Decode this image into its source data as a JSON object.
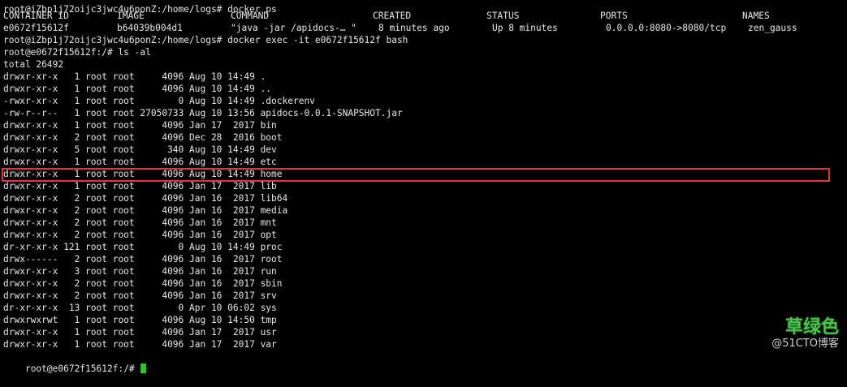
{
  "terminal": {
    "header_lines": [
      "root@iZbp1j72oijc3jwc4u6ponZ:/home/logs# docker ps"
    ],
    "ps_header": {
      "container_id": "CONTAINER ID",
      "image": "IMAGE",
      "command": "COMMAND",
      "created": "CREATED",
      "status": "STATUS",
      "ports": "PORTS",
      "names": "NAMES"
    },
    "ps_row": {
      "container_id": "e0672f15612f",
      "image": "b64039b004d1",
      "command": "\"java -jar /apidocs-… \"",
      "created": "8 minutes ago",
      "status": "Up 8 minutes",
      "ports": "0.0.0.0:8080->8080/tcp",
      "names": "zen_gauss"
    },
    "after_lines": [
      "root@iZbp1j72oijc3jwc4u6ponZ:/home/logs# docker exec -it e0672f15612f bash",
      "root@e0672f15612f:/# ls -al",
      "total 26492"
    ],
    "listing": [
      "drwxr-xr-x   1 root root     4096 Aug 10 14:49 .",
      "drwxr-xr-x   1 root root     4096 Aug 10 14:49 ..",
      "-rwxr-xr-x   1 root root        0 Aug 10 14:49 .dockerenv",
      "-rw-r--r--   1 root root 27050733 Aug 10 13:56 apidocs-0.0.1-SNAPSHOT.jar",
      "drwxr-xr-x   1 root root     4096 Jan 17  2017 bin",
      "drwxr-xr-x   2 root root     4096 Dec 28  2016 boot",
      "drwxr-xr-x   5 root root      340 Aug 10 14:49 dev",
      "drwxr-xr-x   1 root root     4096 Aug 10 14:49 etc",
      "drwxr-xr-x   1 root root     4096 Aug 10 14:49 home",
      "drwxr-xr-x   1 root root     4096 Jan 17  2017 lib",
      "drwxr-xr-x   2 root root     4096 Jan 16  2017 lib64",
      "drwxr-xr-x   2 root root     4096 Jan 16  2017 media",
      "drwxr-xr-x   2 root root     4096 Jan 16  2017 mnt",
      "drwxr-xr-x   2 root root     4096 Jan 16  2017 opt",
      "dr-xr-xr-x 121 root root        0 Aug 10 14:49 proc",
      "drwx------   2 root root     4096 Jan 16  2017 root",
      "drwxr-xr-x   3 root root     4096 Jan 16  2017 run",
      "drwxr-xr-x   2 root root     4096 Jan 16  2017 sbin",
      "drwxr-xr-x   2 root root     4096 Jan 16  2017 srv",
      "dr-xr-xr-x  13 root root        0 Apr 10 06:02 sys",
      "drwxrwxrwt   1 root root     4096 Aug 10 14:50 tmp",
      "drwxr-xr-x   1 root root     4096 Jan 17  2017 usr",
      "drwxr-xr-x   1 root root     4096 Jan 17  2017 var"
    ],
    "highlighted_entry": "home",
    "prompt": "root@e0672f15612f:/# ",
    "highlight_color": "#e0363a",
    "cursor_color": "#19d219"
  },
  "watermark": {
    "brand": "草绿色",
    "site": "@51CTO博客",
    "brand_color": "#48c24a"
  }
}
